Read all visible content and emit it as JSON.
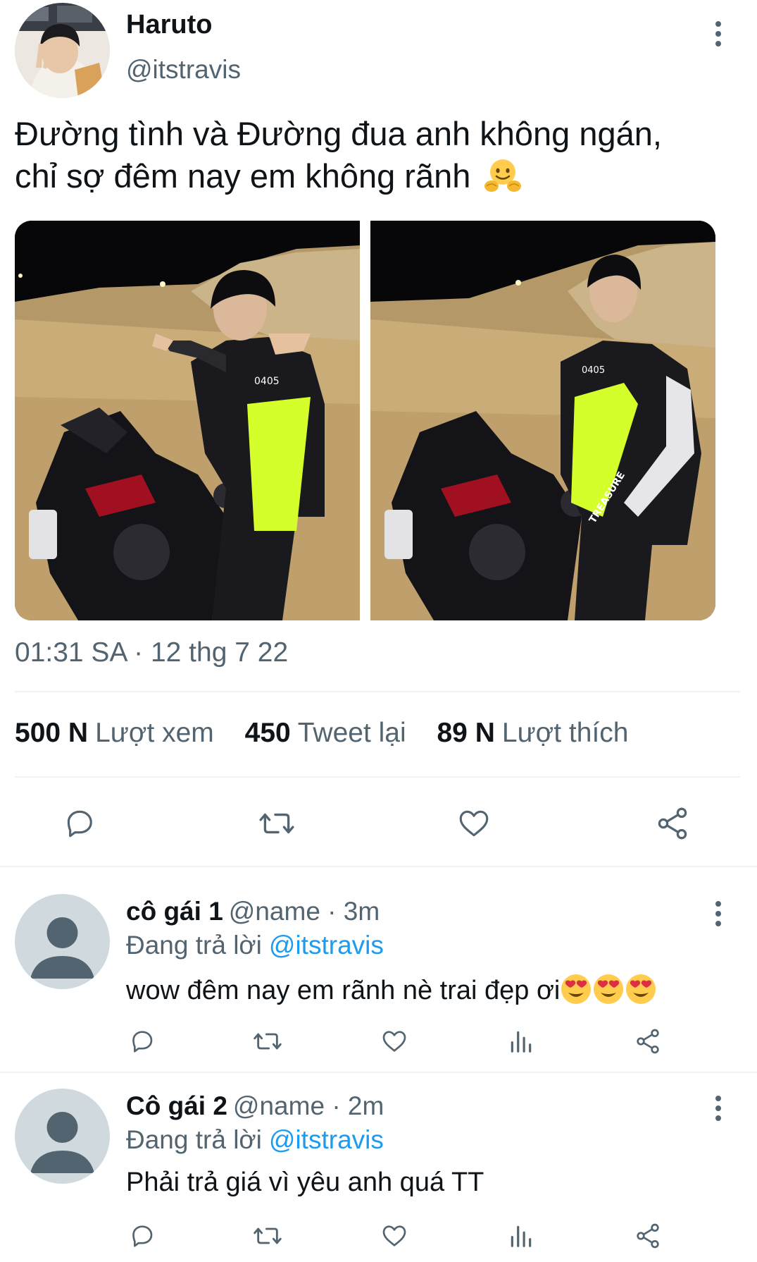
{
  "tweet": {
    "author_name": "Haruto",
    "author_handle": "@itstravis",
    "text_line1": "Đường tình và Đường đua anh không ngán,",
    "text_line2": "chỉ sợ đêm nay em không rãnh",
    "text_emoji": "hugging-face-emoji",
    "timestamp": "01:31 SA · 12 thg 7 22",
    "stats": [
      {
        "value": "500 N",
        "label": "Lượt xem"
      },
      {
        "value": "450",
        "label": "Tweet lại"
      },
      {
        "value": "89 N",
        "label": "Lượt thích"
      }
    ],
    "photos": [
      {
        "jacket_text": "0405"
      },
      {
        "jacket_text": "0405",
        "sleeve_text": "TREASURE"
      }
    ],
    "actions": [
      "reply-icon",
      "retweet-icon",
      "like-icon",
      "share-icon"
    ]
  },
  "replies": [
    {
      "name": "cô gái 1",
      "meta": "@name · 3m",
      "replying_prefix": "Đang trả lời",
      "replying_to": "@itstravis",
      "text": "wow đêm nay em rãnh nè trai đẹp ơi",
      "emojis": "heart-eyes-emoji x3"
    },
    {
      "name": "Cô gái 2",
      "meta": "@name · 2m",
      "replying_prefix": "Đang trả lời",
      "replying_to": "@itstravis",
      "text": "Phải trả giá vì yêu anh quá TT"
    }
  ],
  "colors": {
    "text": "#0f1419",
    "secondary": "#536471",
    "link": "#1d9bf0",
    "divider": "#eff3f4"
  }
}
